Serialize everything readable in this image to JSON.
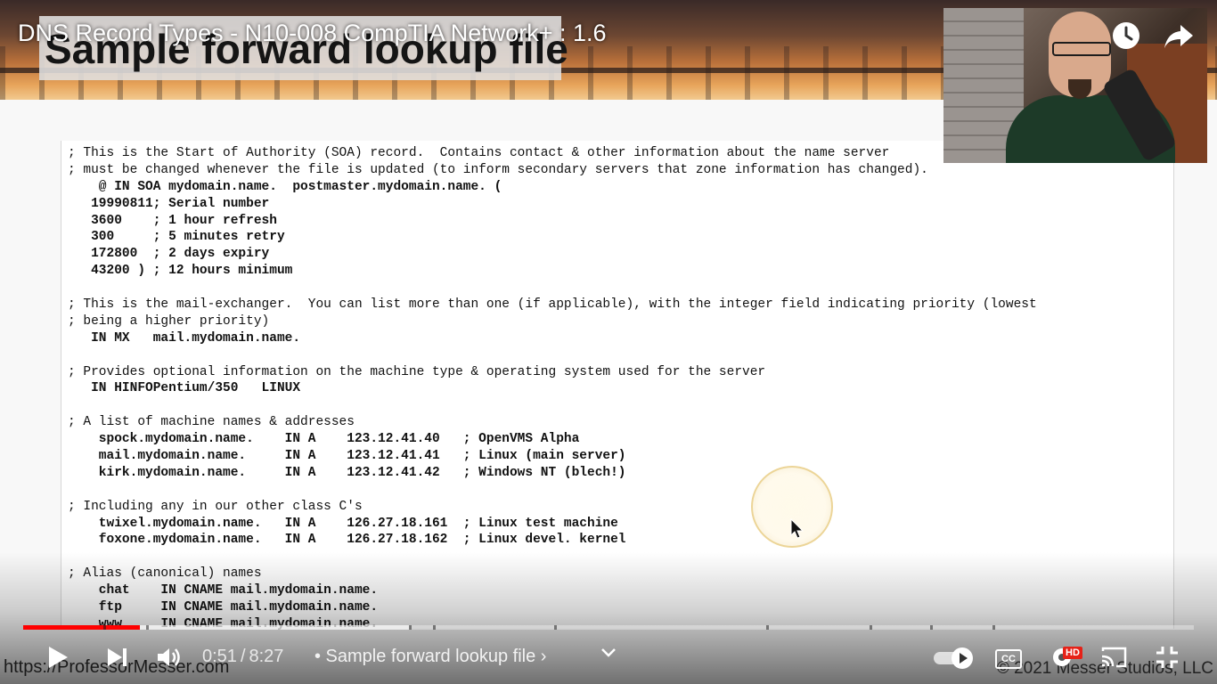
{
  "video": {
    "title": "DNS Record Types - N10-008 CompTIA Network+ : 1.6",
    "watch_later_icon": "clock-icon",
    "share_icon": "share-arrow-icon"
  },
  "slide": {
    "title": "Sample forward lookup file",
    "footer_url": "https://ProfessorMesser.com",
    "copyright": "© 2021 Messer Studios, LLC",
    "code_lines": [
      {
        "text": "; This is the Start of Authority (SOA) record.  Contains contact & other information about the name server",
        "bold": false
      },
      {
        "text": "; must be changed whenever the file is updated (to inform secondary servers that zone information has changed).",
        "bold": false
      },
      {
        "text": "    @ IN SOA mydomain.name.  postmaster.mydomain.name. (",
        "bold": true
      },
      {
        "text": "   19990811; Serial number",
        "bold": true
      },
      {
        "text": "   3600    ; 1 hour refresh",
        "bold": true
      },
      {
        "text": "   300     ; 5 minutes retry",
        "bold": true
      },
      {
        "text": "   172800  ; 2 days expiry",
        "bold": true
      },
      {
        "text": "   43200 ) ; 12 hours minimum",
        "bold": true
      },
      {
        "text": "",
        "bold": false
      },
      {
        "text": "; This is the mail-exchanger.  You can list more than one (if applicable), with the integer field indicating priority (lowest",
        "bold": false
      },
      {
        "text": "; being a higher priority)",
        "bold": false
      },
      {
        "text": "   IN MX   mail.mydomain.name.",
        "bold": true
      },
      {
        "text": "",
        "bold": false
      },
      {
        "text": "; Provides optional information on the machine type & operating system used for the server",
        "bold": false
      },
      {
        "text": "   IN HINFOPentium/350   LINUX",
        "bold": true
      },
      {
        "text": "",
        "bold": false
      },
      {
        "text": "; A list of machine names & addresses",
        "bold": false
      },
      {
        "text": "    spock.mydomain.name.    IN A    123.12.41.40   ; OpenVMS Alpha",
        "bold": true
      },
      {
        "text": "    mail.mydomain.name.     IN A    123.12.41.41   ; Linux (main server)",
        "bold": true
      },
      {
        "text": "    kirk.mydomain.name.     IN A    123.12.41.42   ; Windows NT (blech!)",
        "bold": true
      },
      {
        "text": "",
        "bold": false
      },
      {
        "text": "; Including any in our other class C's",
        "bold": false
      },
      {
        "text": "    twixel.mydomain.name.   IN A    126.27.18.161  ; Linux test machine",
        "bold": true
      },
      {
        "text": "    foxone.mydomain.name.   IN A    126.27.18.162  ; Linux devel. kernel",
        "bold": true
      },
      {
        "text": "",
        "bold": false
      },
      {
        "text": "; Alias (canonical) names",
        "bold": false
      },
      {
        "text": "    chat    IN CNAME mail.mydomain.name.",
        "bold": true
      },
      {
        "text": "    ftp     IN CNAME mail.mydomain.name.",
        "bold": true
      },
      {
        "text": "    www     IN CNAME mail.mydomain.name.",
        "bold": true
      }
    ]
  },
  "player": {
    "current_time": "0:51",
    "separator": "/",
    "duration": "8:27",
    "chapter": "• Sample forward lookup file ›",
    "progress_played": 0.1,
    "progress_loaded": 0.33,
    "hd_label": "HD",
    "cc_label": "CC",
    "autoplay_on": true,
    "colors": {
      "played": "#ff0000",
      "icons": "#ffffff"
    }
  }
}
